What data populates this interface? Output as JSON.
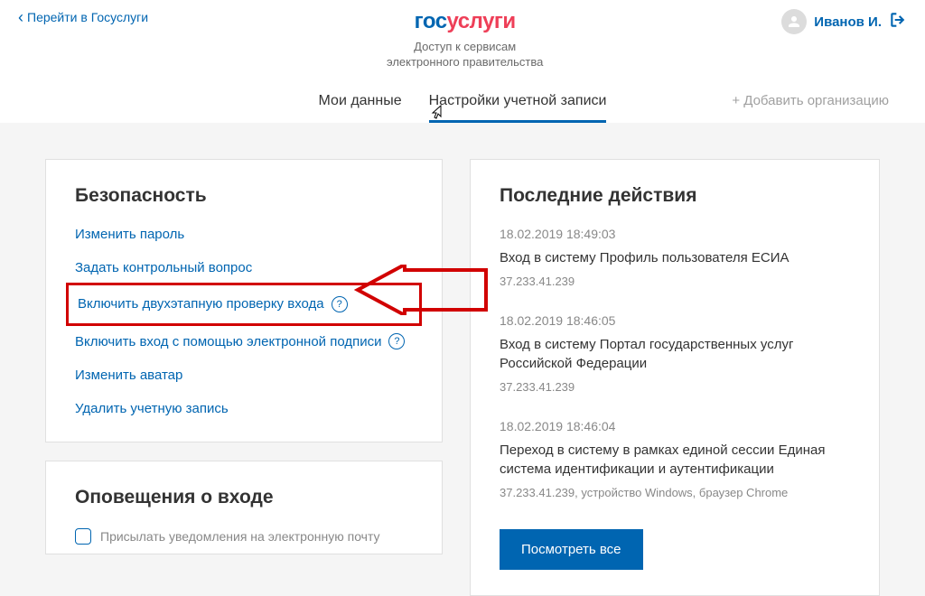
{
  "header": {
    "back_link": "Перейти в Госуслуги",
    "logo_gos": "гос",
    "logo_uslugi": "услуги",
    "subtitle_line1": "Доступ к сервисам",
    "subtitle_line2": "электронного правительства",
    "user_name": "Иванов И."
  },
  "tabs": {
    "my_data": "Мои данные",
    "account_settings": "Настройки учетной записи",
    "add_org": "+ Добавить организацию"
  },
  "security": {
    "title": "Безопасность",
    "change_password": "Изменить пароль",
    "set_question": "Задать контрольный вопрос",
    "enable_2fa": "Включить двухэтапную проверку входа",
    "enable_signature": "Включить вход с помощью электронной подписи",
    "change_avatar": "Изменить аватар",
    "delete_account": "Удалить учетную запись"
  },
  "notifications": {
    "title": "Оповещения о входе",
    "checkbox_label": "Присылать уведомления на электронную почту"
  },
  "recent": {
    "title": "Последние действия",
    "items": [
      {
        "date": "18.02.2019 18:49:03",
        "title": "Вход в систему Профиль пользователя ЕСИА",
        "meta": "37.233.41.239"
      },
      {
        "date": "18.02.2019 18:46:05",
        "title": "Вход в систему Портал государственных услуг Российской Федерации",
        "meta": "37.233.41.239"
      },
      {
        "date": "18.02.2019 18:46:04",
        "title": "Переход в систему в рамках единой сессии Единая система идентификации и аутентификации",
        "meta": "37.233.41.239, устройство Windows, браузер Chrome"
      }
    ],
    "view_all": "Посмотреть все"
  }
}
